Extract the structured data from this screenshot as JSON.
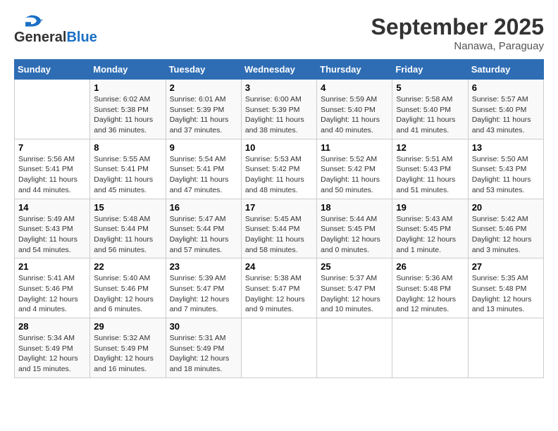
{
  "header": {
    "logo_general": "General",
    "logo_blue": "Blue",
    "month": "September 2025",
    "location": "Nanawa, Paraguay"
  },
  "days_of_week": [
    "Sunday",
    "Monday",
    "Tuesday",
    "Wednesday",
    "Thursday",
    "Friday",
    "Saturday"
  ],
  "weeks": [
    [
      {
        "day": "",
        "info": ""
      },
      {
        "day": "1",
        "info": "Sunrise: 6:02 AM\nSunset: 5:38 PM\nDaylight: 11 hours\nand 36 minutes."
      },
      {
        "day": "2",
        "info": "Sunrise: 6:01 AM\nSunset: 5:39 PM\nDaylight: 11 hours\nand 37 minutes."
      },
      {
        "day": "3",
        "info": "Sunrise: 6:00 AM\nSunset: 5:39 PM\nDaylight: 11 hours\nand 38 minutes."
      },
      {
        "day": "4",
        "info": "Sunrise: 5:59 AM\nSunset: 5:40 PM\nDaylight: 11 hours\nand 40 minutes."
      },
      {
        "day": "5",
        "info": "Sunrise: 5:58 AM\nSunset: 5:40 PM\nDaylight: 11 hours\nand 41 minutes."
      },
      {
        "day": "6",
        "info": "Sunrise: 5:57 AM\nSunset: 5:40 PM\nDaylight: 11 hours\nand 43 minutes."
      }
    ],
    [
      {
        "day": "7",
        "info": "Sunrise: 5:56 AM\nSunset: 5:41 PM\nDaylight: 11 hours\nand 44 minutes."
      },
      {
        "day": "8",
        "info": "Sunrise: 5:55 AM\nSunset: 5:41 PM\nDaylight: 11 hours\nand 45 minutes."
      },
      {
        "day": "9",
        "info": "Sunrise: 5:54 AM\nSunset: 5:41 PM\nDaylight: 11 hours\nand 47 minutes."
      },
      {
        "day": "10",
        "info": "Sunrise: 5:53 AM\nSunset: 5:42 PM\nDaylight: 11 hours\nand 48 minutes."
      },
      {
        "day": "11",
        "info": "Sunrise: 5:52 AM\nSunset: 5:42 PM\nDaylight: 11 hours\nand 50 minutes."
      },
      {
        "day": "12",
        "info": "Sunrise: 5:51 AM\nSunset: 5:43 PM\nDaylight: 11 hours\nand 51 minutes."
      },
      {
        "day": "13",
        "info": "Sunrise: 5:50 AM\nSunset: 5:43 PM\nDaylight: 11 hours\nand 53 minutes."
      }
    ],
    [
      {
        "day": "14",
        "info": "Sunrise: 5:49 AM\nSunset: 5:43 PM\nDaylight: 11 hours\nand 54 minutes."
      },
      {
        "day": "15",
        "info": "Sunrise: 5:48 AM\nSunset: 5:44 PM\nDaylight: 11 hours\nand 56 minutes."
      },
      {
        "day": "16",
        "info": "Sunrise: 5:47 AM\nSunset: 5:44 PM\nDaylight: 11 hours\nand 57 minutes."
      },
      {
        "day": "17",
        "info": "Sunrise: 5:45 AM\nSunset: 5:44 PM\nDaylight: 11 hours\nand 58 minutes."
      },
      {
        "day": "18",
        "info": "Sunrise: 5:44 AM\nSunset: 5:45 PM\nDaylight: 12 hours\nand 0 minutes."
      },
      {
        "day": "19",
        "info": "Sunrise: 5:43 AM\nSunset: 5:45 PM\nDaylight: 12 hours\nand 1 minute."
      },
      {
        "day": "20",
        "info": "Sunrise: 5:42 AM\nSunset: 5:46 PM\nDaylight: 12 hours\nand 3 minutes."
      }
    ],
    [
      {
        "day": "21",
        "info": "Sunrise: 5:41 AM\nSunset: 5:46 PM\nDaylight: 12 hours\nand 4 minutes."
      },
      {
        "day": "22",
        "info": "Sunrise: 5:40 AM\nSunset: 5:46 PM\nDaylight: 12 hours\nand 6 minutes."
      },
      {
        "day": "23",
        "info": "Sunrise: 5:39 AM\nSunset: 5:47 PM\nDaylight: 12 hours\nand 7 minutes."
      },
      {
        "day": "24",
        "info": "Sunrise: 5:38 AM\nSunset: 5:47 PM\nDaylight: 12 hours\nand 9 minutes."
      },
      {
        "day": "25",
        "info": "Sunrise: 5:37 AM\nSunset: 5:47 PM\nDaylight: 12 hours\nand 10 minutes."
      },
      {
        "day": "26",
        "info": "Sunrise: 5:36 AM\nSunset: 5:48 PM\nDaylight: 12 hours\nand 12 minutes."
      },
      {
        "day": "27",
        "info": "Sunrise: 5:35 AM\nSunset: 5:48 PM\nDaylight: 12 hours\nand 13 minutes."
      }
    ],
    [
      {
        "day": "28",
        "info": "Sunrise: 5:34 AM\nSunset: 5:49 PM\nDaylight: 12 hours\nand 15 minutes."
      },
      {
        "day": "29",
        "info": "Sunrise: 5:32 AM\nSunset: 5:49 PM\nDaylight: 12 hours\nand 16 minutes."
      },
      {
        "day": "30",
        "info": "Sunrise: 5:31 AM\nSunset: 5:49 PM\nDaylight: 12 hours\nand 18 minutes."
      },
      {
        "day": "",
        "info": ""
      },
      {
        "day": "",
        "info": ""
      },
      {
        "day": "",
        "info": ""
      },
      {
        "day": "",
        "info": ""
      }
    ]
  ]
}
